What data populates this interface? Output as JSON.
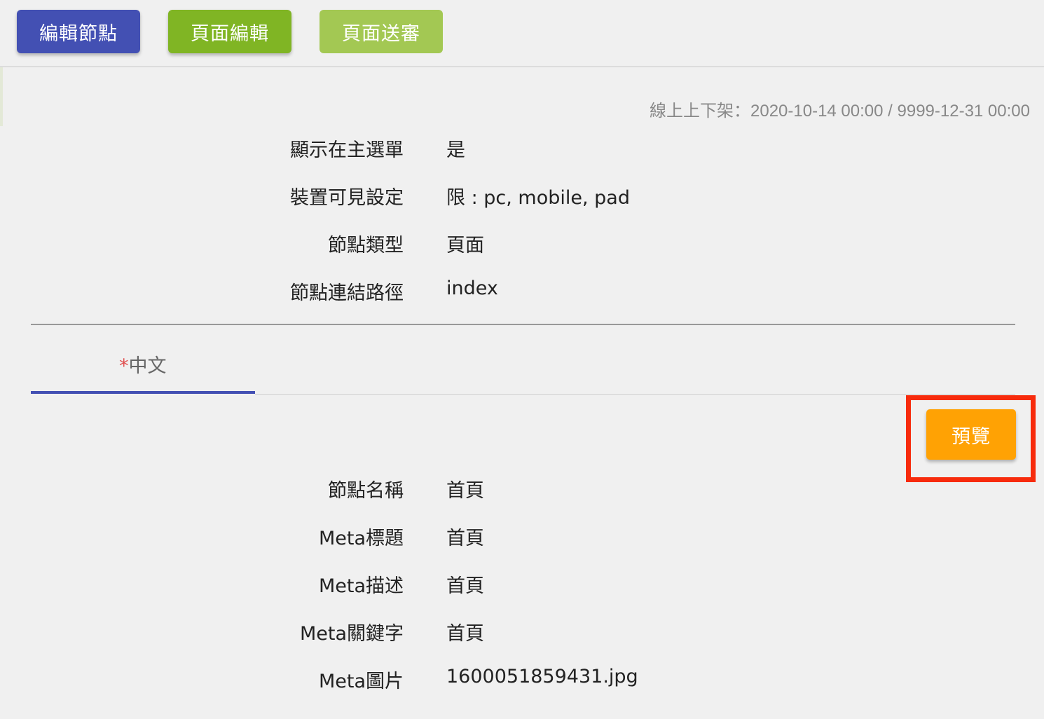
{
  "toolbar": {
    "edit_node_label": "編輯節點",
    "edit_page_label": "頁面編輯",
    "submit_page_label": "頁面送審"
  },
  "schedule": {
    "text": "線上上下架：2020-10-14 00:00 / 9999-12-31 00:00"
  },
  "node_info": [
    {
      "label": "顯示在主選單",
      "value": "是"
    },
    {
      "label": "裝置可見設定",
      "value": "限 : pc, mobile, pad"
    },
    {
      "label": "節點類型",
      "value": "頁面"
    },
    {
      "label": "節點連結路徑",
      "value": "index"
    }
  ],
  "tabs": [
    {
      "required_mark": "*",
      "label": "中文"
    }
  ],
  "preview_button": {
    "label": "預覽"
  },
  "meta_info": [
    {
      "label": "節點名稱",
      "value": "首頁"
    },
    {
      "label": "Meta標題",
      "value": "首頁"
    },
    {
      "label": "Meta描述",
      "value": "首頁"
    },
    {
      "label": "Meta關鍵字",
      "value": "首頁"
    },
    {
      "label": "Meta圖片",
      "value": "1600051859431.jpg"
    }
  ],
  "colors": {
    "primary": "#4350b3",
    "edit_green": "#80b524",
    "submit_green_light": "#a3c853",
    "preview_orange": "#ffa204",
    "highlight_red": "#f72b0c"
  }
}
